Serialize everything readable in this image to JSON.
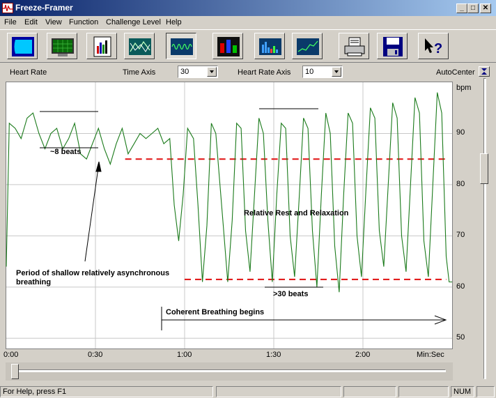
{
  "window": {
    "title": "Freeze-Framer",
    "controls": {
      "minimize": "_",
      "maximize": "□",
      "close": "✕"
    }
  },
  "menu": [
    "File",
    "Edit",
    "View",
    "Function",
    "Challenge Level",
    "Help"
  ],
  "toolbar": {
    "buttons": [
      {
        "icon": "blank-screen-icon"
      },
      {
        "icon": "monitor-grid-icon"
      },
      {
        "icon": "report-chart-icon"
      },
      {
        "icon": "line-graph-icon"
      },
      {
        "icon": "heart-rate-wave-icon",
        "pressed": true
      },
      {
        "icon": "challenge-bars-icon"
      },
      {
        "icon": "spectrum-bars-icon"
      },
      {
        "icon": "trend-line-icon"
      },
      {
        "icon": "printer-icon"
      },
      {
        "icon": "save-disk-icon"
      },
      {
        "icon": "help-cursor-icon"
      }
    ]
  },
  "controls": {
    "heart_rate_label": "Heart Rate",
    "time_axis_label": "Time Axis",
    "time_axis_value": "30",
    "heart_rate_axis_label": "Heart Rate Axis",
    "heart_rate_axis_value": "10",
    "autocenter_label": "AutoCenter"
  },
  "chart_data": {
    "type": "line",
    "title": "",
    "xlabel": "Min:Sec",
    "ylabel": "bpm",
    "x_ticks": [
      "0:00",
      "0:30",
      "1:00",
      "1:30",
      "2:00"
    ],
    "x_tick_seconds": [
      0,
      30,
      60,
      90,
      120
    ],
    "xlim": [
      0,
      150
    ],
    "y_ticks": [
      50,
      60,
      70,
      80,
      90
    ],
    "ylim": [
      48,
      100
    ],
    "grid": true,
    "series": [
      {
        "color": "#1a7a1a",
        "x": [
          0,
          1,
          3,
          5,
          7,
          9,
          11,
          13,
          15,
          17,
          19,
          21,
          23,
          25,
          27,
          29,
          31,
          33,
          35,
          37,
          39,
          41,
          43,
          45,
          47,
          49,
          51,
          53,
          55,
          56.5,
          58,
          59.5,
          61,
          63,
          64.5,
          66,
          67.5,
          69,
          70.5,
          73,
          74.5,
          76,
          77.5,
          79,
          80.5,
          82,
          83.5,
          85,
          86.5,
          88,
          89.5,
          91,
          92.5,
          94,
          95.5,
          97,
          98.5,
          100,
          101.5,
          103,
          104.5,
          106,
          107.5,
          109,
          110.5,
          112,
          113.5,
          115,
          116.5,
          118,
          119.5,
          121,
          122.5,
          124,
          125.5,
          127,
          128.5,
          130,
          131.5,
          133,
          134.5,
          136,
          137.5,
          139,
          140.5,
          142,
          143.5,
          145,
          146.5,
          148,
          149,
          150
        ],
        "y": [
          64,
          92,
          91,
          89,
          93,
          94,
          90,
          87,
          90,
          91,
          87,
          89,
          92,
          86,
          85,
          88,
          91,
          87,
          84,
          88,
          91,
          86,
          88,
          90,
          89,
          90,
          91,
          88,
          89,
          76,
          69,
          78,
          91,
          89,
          76,
          61,
          72,
          92,
          90,
          72,
          61,
          73,
          92,
          91,
          71,
          63,
          78,
          93,
          90,
          73,
          61,
          78,
          92,
          91,
          70,
          62,
          77,
          93,
          91,
          71,
          60,
          78,
          94,
          90,
          68,
          59,
          78,
          94,
          92,
          70,
          62,
          79,
          95,
          93,
          71,
          64,
          80,
          96,
          93,
          70,
          63,
          80,
          97,
          94,
          69,
          62,
          80,
          98,
          94,
          66,
          61,
          61
        ]
      }
    ],
    "annotations": [
      {
        "text": "~8 beats"
      },
      {
        "text": "Period of shallow relatively asynchronous\nbreathing"
      },
      {
        "text": "Relative Rest and Relaxation"
      },
      {
        "text": ">30 beats"
      },
      {
        "text": "Coherent Breathing begins"
      }
    ],
    "reference_lines": [
      {
        "style": "dashed",
        "color": "#e01010",
        "y": 85,
        "x_range": [
          40,
          148
        ]
      },
      {
        "style": "dashed",
        "color": "#e01010",
        "y": 61.5,
        "x_range": [
          60,
          148
        ]
      }
    ]
  },
  "status": {
    "help_text": "For Help, press F1",
    "num": "NUM"
  }
}
